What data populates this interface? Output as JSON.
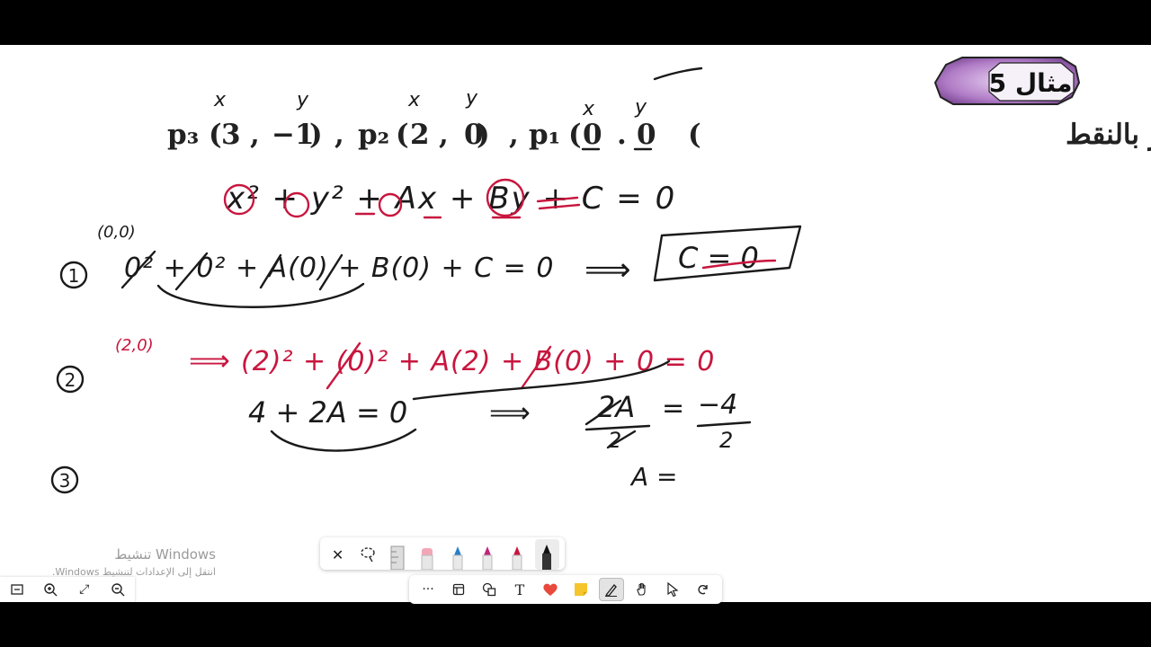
{
  "header": {
    "example_label": "مثال 5",
    "problem_text": "جد معادلة الدائرة التي تمر بالنقط",
    "points": [
      {
        "name": "p₁",
        "x": "0",
        "y": "0"
      },
      {
        "name": "p₂",
        "x": "2",
        "y": "0"
      },
      {
        "name": "p₃",
        "x": "3",
        "y": "−1"
      }
    ],
    "var_x": "x",
    "var_y": "y"
  },
  "work": {
    "general_equation": "x² + y² + Ax + By + C = 0",
    "step1": {
      "marker": "1",
      "point": "(0,0)",
      "equation": "0² + 0² + A(0) + B(0) + C = 0",
      "implies": "⟹",
      "result": "C = 0"
    },
    "step2": {
      "marker": "2",
      "point": "(2,0)",
      "implies": "⟹",
      "substitution": "(2)² + (0)² + A(2) + B(0) + 0 = 0",
      "simplified": "4 + 2A = 0",
      "implies2": "⟹",
      "isolate_lhs": "2A",
      "isolate_rhs_num": "−4",
      "isolate_rhs_den": "2",
      "isolate_den_lhs": "2",
      "a_line": "A ="
    },
    "step3": {
      "marker": "3"
    }
  },
  "watermark": {
    "title": "تنشيط Windows",
    "subtitle": "انتقل إلى الإعدادات لتنشيط Windows."
  },
  "toolbar": {
    "more_icon": "···",
    "text_label": "T",
    "zoom_label": "⤢"
  },
  "colors": {
    "ink_black": "#1a1a1a",
    "ink_red": "#c8163e",
    "badge_purple": "#b07cc6"
  }
}
